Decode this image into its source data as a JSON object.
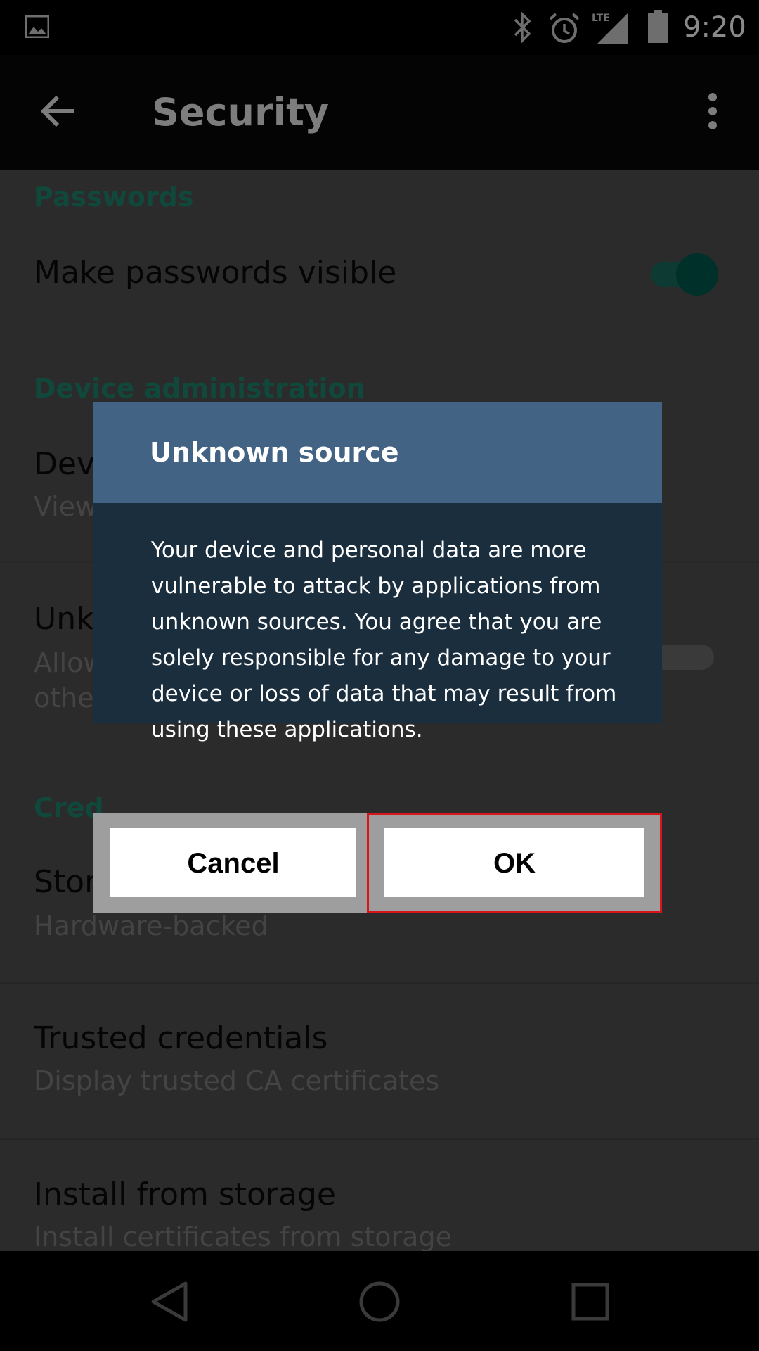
{
  "status_bar": {
    "time": "9:20",
    "icons": [
      "image-icon",
      "bluetooth-icon",
      "alarm-icon",
      "lte-signal-icon",
      "battery-icon"
    ],
    "network_label": "LTE"
  },
  "app_bar": {
    "title": "Security",
    "back_icon": "back-arrow-icon",
    "menu_icon": "more-vert-icon"
  },
  "settings": {
    "section_passwords": "Passwords",
    "make_passwords_visible": "Make passwords visible",
    "section_device_admin": "Device administration",
    "device_admins_title": "Devi",
    "device_admins_sub": "View",
    "unknown_sources_title": "Unkn",
    "unknown_sources_sub_line1": "Allow",
    "unknown_sources_sub_line2": "other",
    "section_credential": "Cred",
    "storage_type_title": "Stor",
    "storage_type_sub": "Hardware-backed",
    "trusted_credentials_title": "Trusted credentials",
    "trusted_credentials_sub": "Display trusted CA certificates",
    "install_from_storage_title": "Install from storage",
    "install_from_storage_sub": "Install certificates from storage"
  },
  "dialog": {
    "title": "Unknown source",
    "message": "Your device and personal data are more vulnerable to attack by applications from unknown sources. You agree that you are solely responsible for any damage to your device or loss of data that may result from using these applications.",
    "cancel_label": "Cancel",
    "ok_label": "OK"
  },
  "nav_bar": {
    "icons": [
      "nav-back-icon",
      "nav-home-icon",
      "nav-recents-icon"
    ]
  },
  "colors": {
    "dialog_header": "#426383",
    "dialog_body": "#1b2e3e",
    "highlight_border": "#d9141b",
    "accent": "#10483b"
  }
}
